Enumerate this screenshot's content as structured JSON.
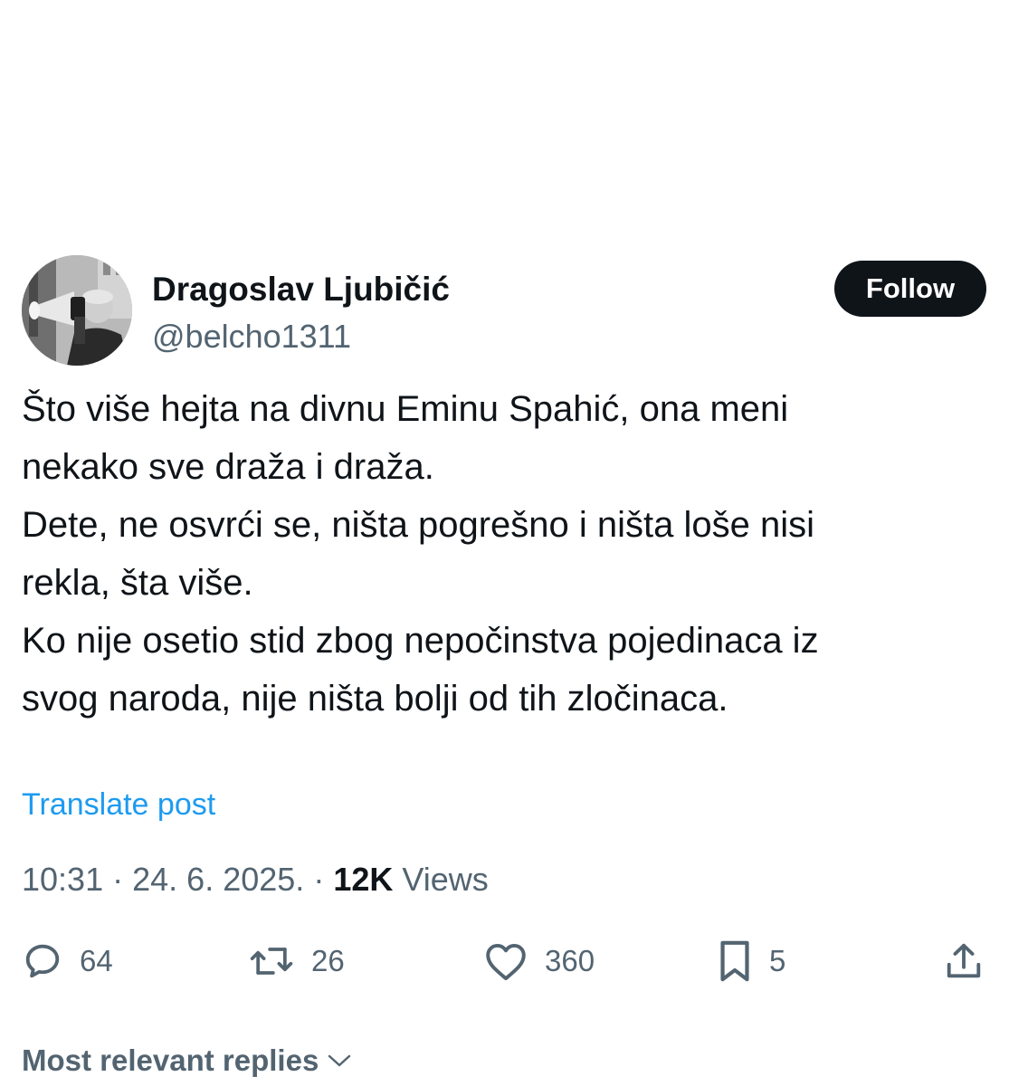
{
  "post": {
    "author": {
      "name": "Dragoslav Ljubičić",
      "handle": "@belcho1311"
    },
    "follow_label": "Follow",
    "text_lines": [
      "Što više hejta na divnu Eminu Spahić, ona meni",
      "nekako sve draža i draža.",
      "Dete, ne osvrći se, ništa pogrešno i ništa loše nisi",
      "rekla, šta više.",
      "Ko nije osetio stid zbog nepočinstva pojedinaca iz",
      "svog naroda, nije ništa bolji od tih zločinaca."
    ],
    "translate_label": "Translate post",
    "meta": {
      "time": "10:31",
      "date": "24. 6. 2025.",
      "separator": "·",
      "views_count": "12K",
      "views_label": "Views"
    },
    "actions": {
      "replies": "64",
      "reposts": "26",
      "likes": "360",
      "bookmarks": "5"
    }
  },
  "replies_sort": {
    "label": "Most relevant replies"
  },
  "colors": {
    "text_primary": "#0f1419",
    "text_secondary": "#536471",
    "link": "#1d9bf0",
    "follow_bg": "#0f1419"
  },
  "icons": [
    "reply-icon",
    "repost-icon",
    "like-icon",
    "bookmark-icon",
    "share-icon",
    "chevron-down-icon"
  ]
}
